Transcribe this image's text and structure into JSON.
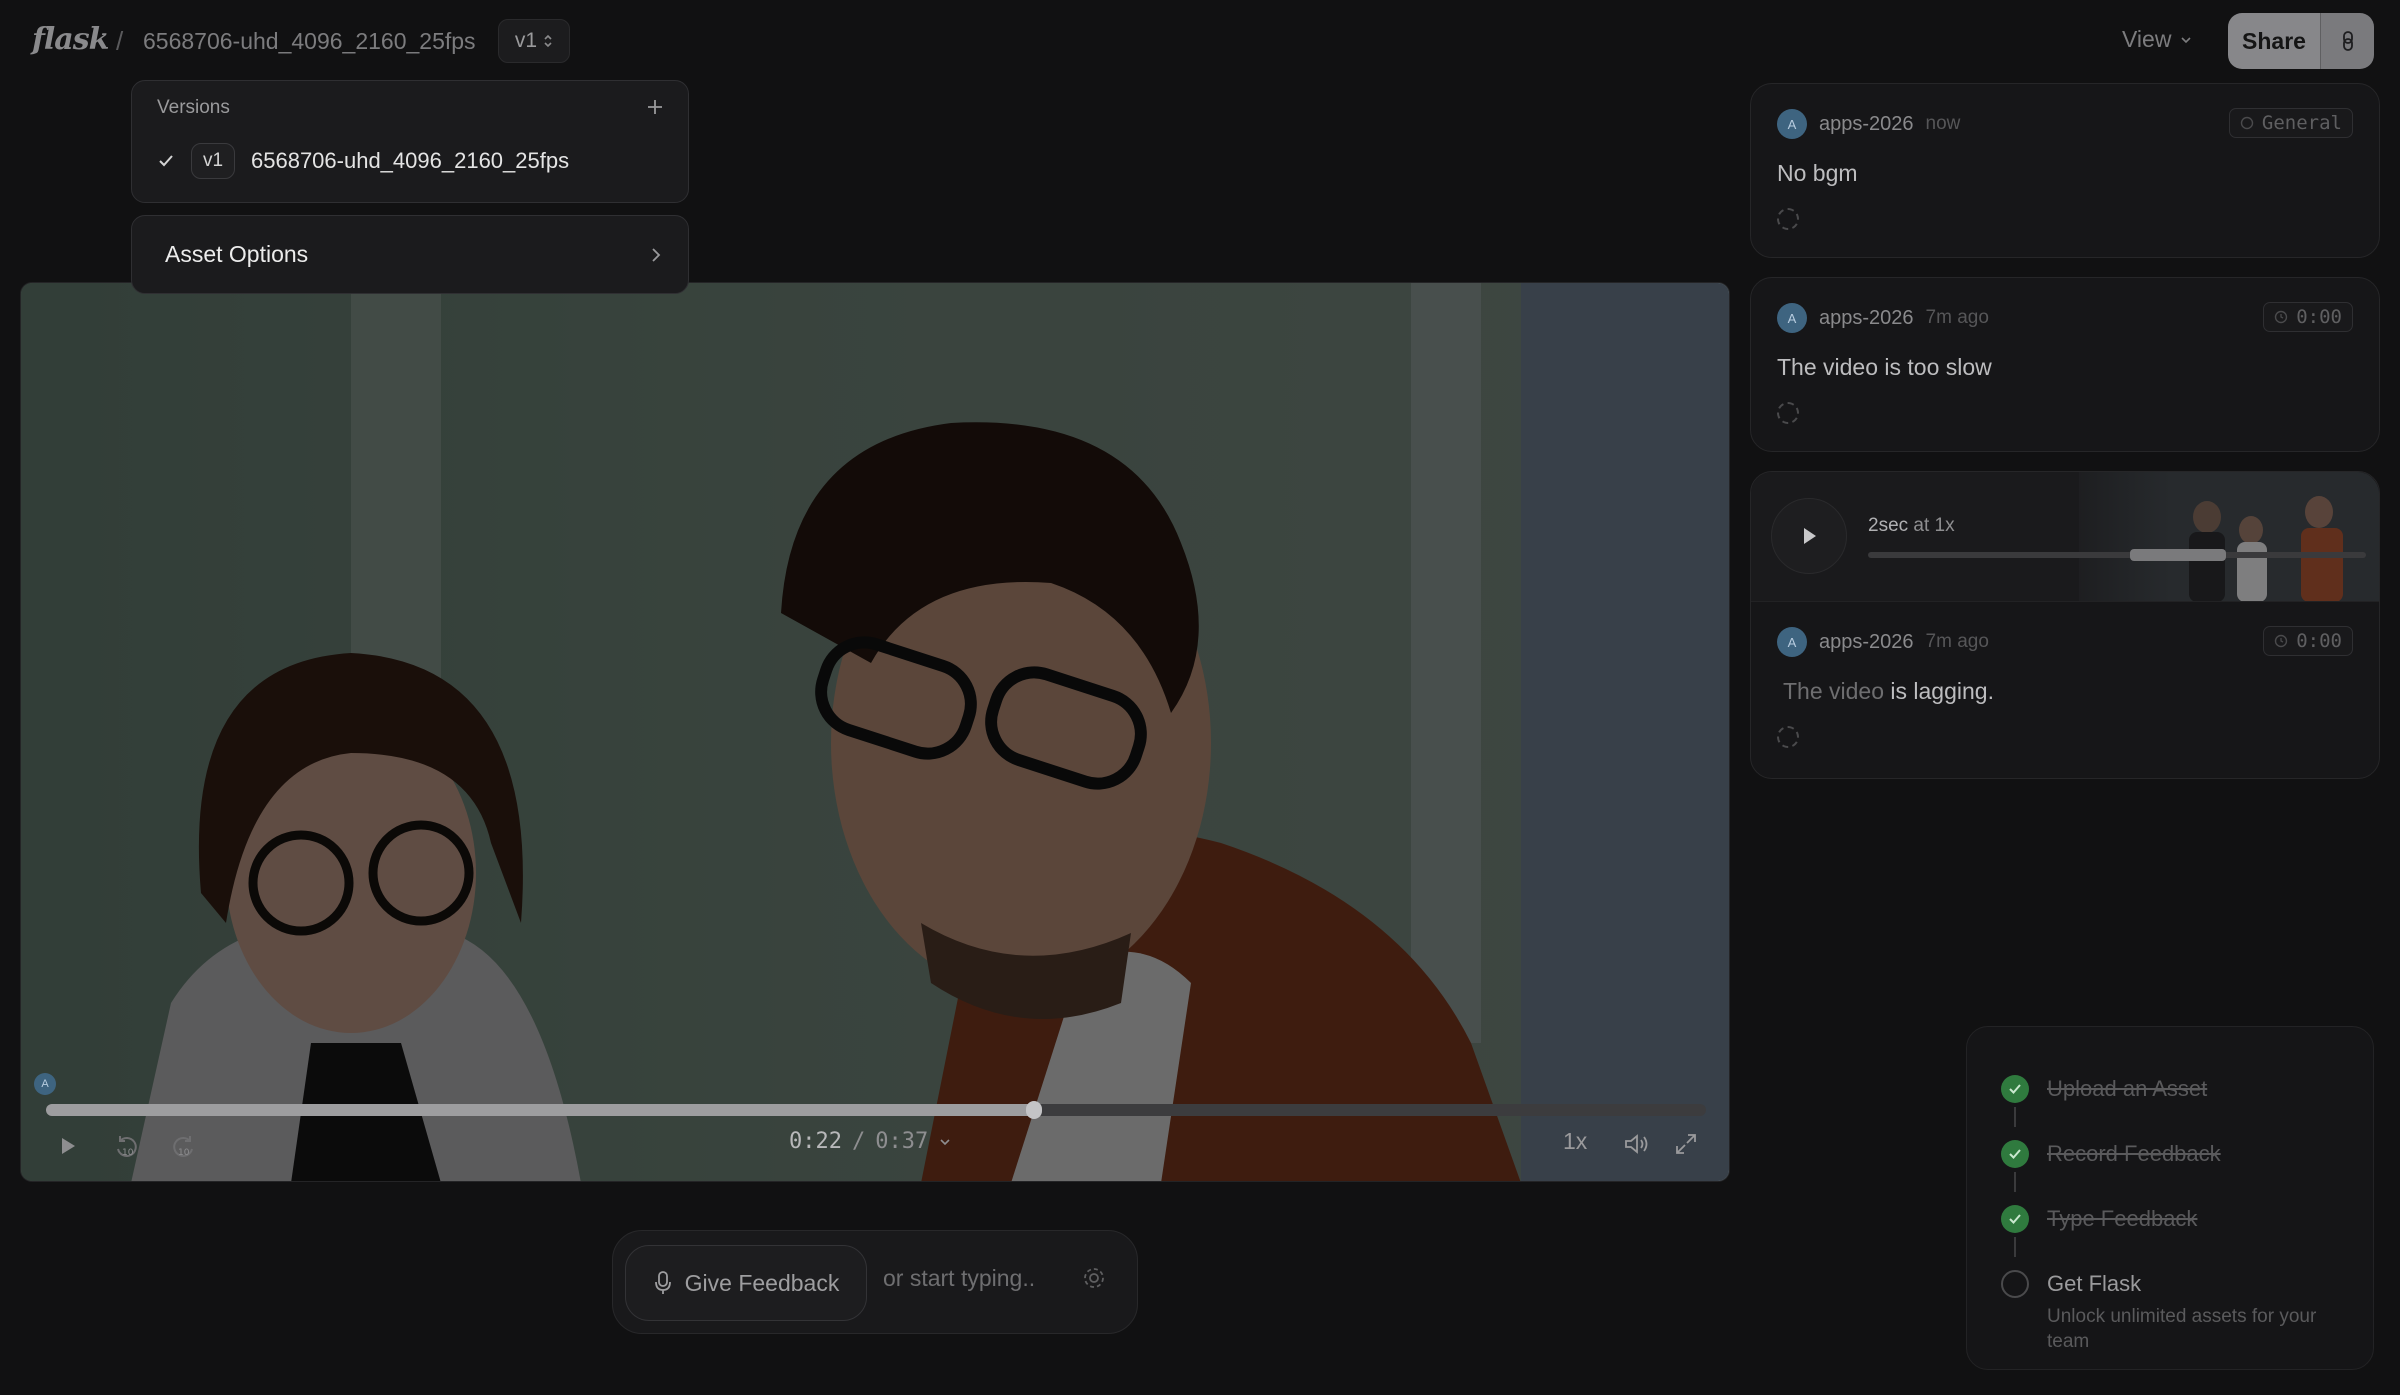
{
  "header": {
    "logo": "flask",
    "separator": "/",
    "asset_name": "6568706-uhd_4096_2160_25fps",
    "version_label": "v1",
    "view_label": "View",
    "share_label": "Share"
  },
  "versions_menu": {
    "title": "Versions",
    "items": [
      {
        "version": "v1",
        "name": "6568706-uhd_4096_2160_25fps",
        "selected": true
      }
    ],
    "asset_options_label": "Asset Options"
  },
  "player": {
    "current_time": "0:22",
    "duration": "0:37",
    "time_separator": "/",
    "progress_fraction": 0.595,
    "speed": "1x",
    "marker_avatar": "A"
  },
  "feedback": {
    "button_label": "Give Feedback",
    "placeholder": "or start typing.."
  },
  "comments": [
    {
      "avatar": "A",
      "user": "apps-2026",
      "time": "now",
      "tag": "General",
      "text": "No bgm"
    },
    {
      "avatar": "A",
      "user": "apps-2026",
      "time": "7m ago",
      "tag": "0:00",
      "text": "The video is too slow"
    },
    {
      "avatar": "A",
      "user": "apps-2026",
      "time": "7m ago",
      "tag": "0:00",
      "text_muted": "The video",
      "text_rest": "is lagging.",
      "audio": {
        "duration_label": "2sec",
        "speed_label": "at 1x"
      }
    }
  ],
  "checklist": {
    "steps": [
      {
        "label": "Upload an Asset",
        "done": true
      },
      {
        "label": "Record Feedback",
        "done": true
      },
      {
        "label": "Type Feedback",
        "done": true
      },
      {
        "label": "Get Flask",
        "done": false,
        "sub": "Unlock unlimited assets for your team"
      }
    ]
  },
  "colors": {
    "background": "#111112",
    "avatar": "#3e6480",
    "done_green": "#2f7a3e"
  },
  "icons": [
    "chevron-up-down-icon",
    "chevron-down-icon",
    "link-icon",
    "plus-icon",
    "check-icon",
    "chevron-right-icon",
    "play-icon",
    "rewind-10-icon",
    "forward-10-icon",
    "volume-icon",
    "fullscreen-icon",
    "microphone-icon",
    "gear-icon",
    "clock-icon"
  ]
}
